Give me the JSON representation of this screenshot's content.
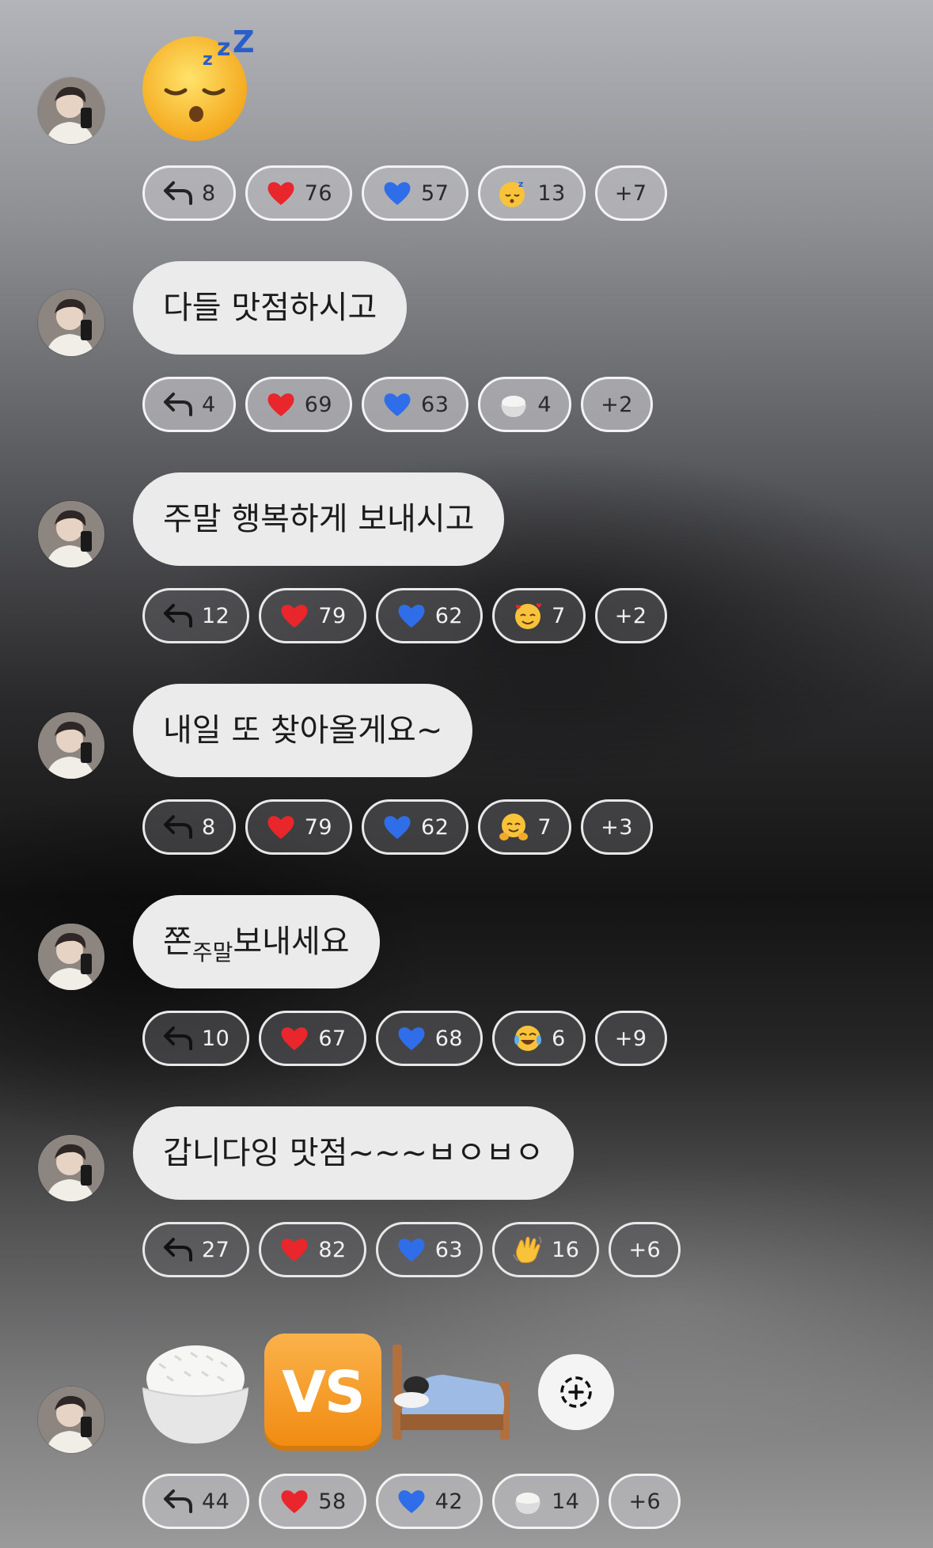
{
  "messages": [
    {
      "type": "emoji",
      "emoji": [
        "sleeping-face"
      ],
      "reactions": {
        "reply": "8",
        "heart": "76",
        "blue_heart": "57",
        "custom_emoji": "sleeping-face",
        "custom": "13",
        "more": "+7"
      }
    },
    {
      "type": "text",
      "text": "다들 맛점하시고",
      "reactions": {
        "reply": "4",
        "heart": "69",
        "blue_heart": "63",
        "custom_emoji": "rice-bowl",
        "custom": "4",
        "more": "+2"
      }
    },
    {
      "type": "text",
      "text": "주말 행복하게 보내시고",
      "reactions": {
        "reply": "12",
        "heart": "79",
        "blue_heart": "62",
        "custom_emoji": "smiling-face-with-hearts",
        "custom": "7",
        "more": "+2"
      }
    },
    {
      "type": "text",
      "text": "내일 또 찾아올게요~",
      "reactions": {
        "reply": "8",
        "heart": "79",
        "blue_heart": "62",
        "custom_emoji": "hugging-face",
        "custom": "7",
        "more": "+3"
      }
    },
    {
      "type": "text",
      "text_a": "쫀",
      "text_sub": "주말",
      "text_b": "보내세요",
      "reactions": {
        "reply": "10",
        "heart": "67",
        "blue_heart": "68",
        "custom_emoji": "tears-of-joy",
        "custom": "6",
        "more": "+9"
      }
    },
    {
      "type": "text",
      "text": "갑니다잉 맛점~~~ㅂㅇㅂㅇ",
      "reactions": {
        "reply": "27",
        "heart": "82",
        "blue_heart": "63",
        "custom_emoji": "waving-hand",
        "custom": "16",
        "more": "+6"
      }
    },
    {
      "type": "emoji",
      "emoji": [
        "rice-bowl",
        "vs-button",
        "bed"
      ],
      "vs_label": "VS",
      "reactions": {
        "reply": "44",
        "heart": "58",
        "blue_heart": "42",
        "custom_emoji": "rice-bowl",
        "custom": "14",
        "more": "+6"
      }
    }
  ],
  "colors": {
    "bubble": "#ebebec",
    "heart": "#e8262b",
    "blue_heart": "#2f6ee8",
    "vs_orange": "#f59a1a"
  }
}
